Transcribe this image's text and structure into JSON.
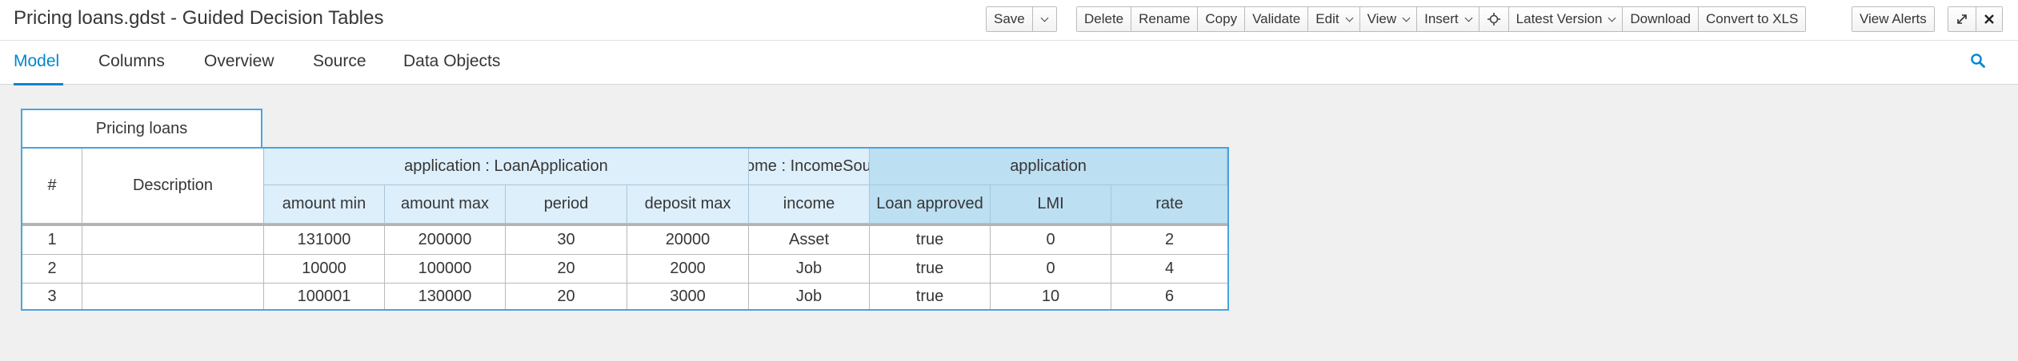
{
  "header": {
    "title": "Pricing loans.gdst - Guided Decision Tables",
    "toolbar": {
      "save": "Save",
      "delete": "Delete",
      "rename": "Rename",
      "copy": "Copy",
      "validate": "Validate",
      "edit": "Edit",
      "view": "View",
      "insert": "Insert",
      "latest_version": "Latest Version",
      "download": "Download",
      "convert": "Convert to XLS",
      "view_alerts": "View Alerts"
    }
  },
  "tabs": [
    "Model",
    "Columns",
    "Overview",
    "Source",
    "Data Objects"
  ],
  "active_tab": "Model",
  "colors": {
    "accent": "#0088ce",
    "table_border": "#4aa3df",
    "condition_header": "#ddeffb",
    "action_header": "#bcdff2"
  },
  "table": {
    "caption": "Pricing loans",
    "row_number_header": "#",
    "description_header": "Description",
    "groups": [
      {
        "label": "application : LoanApplication",
        "type": "condition"
      },
      {
        "label": "ome : IncomeSou",
        "type": "condition"
      },
      {
        "label": "application",
        "type": "action"
      }
    ],
    "columns": [
      "amount min",
      "amount max",
      "period",
      "deposit max",
      "income",
      "Loan approved",
      "LMI",
      "rate"
    ],
    "rows": [
      {
        "num": "1",
        "desc": "",
        "cells": [
          "131000",
          "200000",
          "30",
          "20000",
          "Asset",
          "true",
          "0",
          "2"
        ]
      },
      {
        "num": "2",
        "desc": "",
        "cells": [
          "10000",
          "100000",
          "20",
          "2000",
          "Job",
          "true",
          "0",
          "4"
        ]
      },
      {
        "num": "3",
        "desc": "",
        "cells": [
          "100001",
          "130000",
          "20",
          "3000",
          "Job",
          "true",
          "10",
          "6"
        ]
      }
    ]
  }
}
